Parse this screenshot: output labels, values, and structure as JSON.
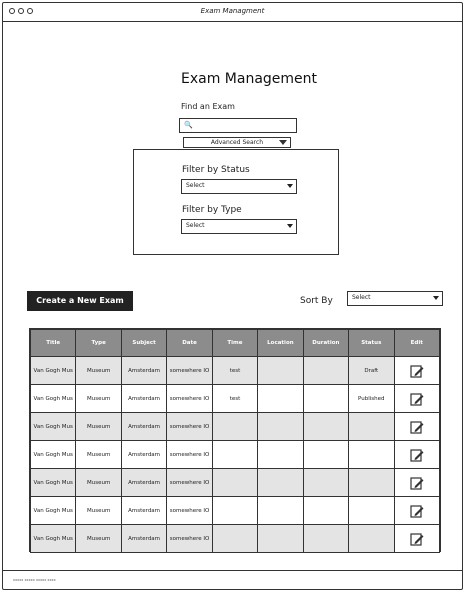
{
  "window": {
    "title": "Exam Managment"
  },
  "page": {
    "title": "Exam Management",
    "find_label": "Find an Exam",
    "advanced_search_label": "Advanced Search"
  },
  "filters": {
    "status_label": "Filter by Status",
    "status_value": "Select",
    "type_label": "Filter by Type",
    "type_value": "Select"
  },
  "actions": {
    "create_label": "Create a New Exam",
    "sort_label": "Sort By",
    "sort_value": "Select"
  },
  "table": {
    "headers": [
      "Title",
      "Type",
      "Subject",
      "Date",
      "Time",
      "Location",
      "Duration",
      "Status",
      "Edit"
    ],
    "rows": [
      [
        "Van Gogh Mus",
        "Museum",
        "Amsterdam",
        "somewhere IO",
        "test",
        "",
        "",
        "Draft"
      ],
      [
        "Van Gogh Mus",
        "Museum",
        "Amsterdam",
        "somewhere IO",
        "test",
        "",
        "",
        "Published"
      ],
      [
        "Van Gogh Mus",
        "Museum",
        "Amsterdam",
        "somewhere IO",
        "",
        "",
        "",
        ""
      ],
      [
        "Van Gogh Mus",
        "Museum",
        "Amsterdam",
        "somewhere IO",
        "",
        "",
        "",
        ""
      ],
      [
        "Van Gogh Mus",
        "Museum",
        "Amsterdam",
        "somewhere IO",
        "",
        "",
        "",
        ""
      ],
      [
        "Van Gogh Mus",
        "Museum",
        "Amsterdam",
        "somewhere IO",
        "",
        "",
        "",
        ""
      ],
      [
        "Van Gogh Mus",
        "Museum",
        "Amsterdam",
        "somewhere IO",
        "",
        "",
        "",
        ""
      ]
    ],
    "shaded_rows": [
      true,
      false,
      true,
      false,
      true,
      false,
      true
    ],
    "edit_icon": "edit-pencil-icon"
  },
  "footer": {
    "text": "xxxxx xxxxx xxxxx xxxx"
  },
  "colors": {
    "header_bg": "#8c8c8c",
    "row_shade": "#e4e4e4",
    "button_bg": "#222222"
  }
}
